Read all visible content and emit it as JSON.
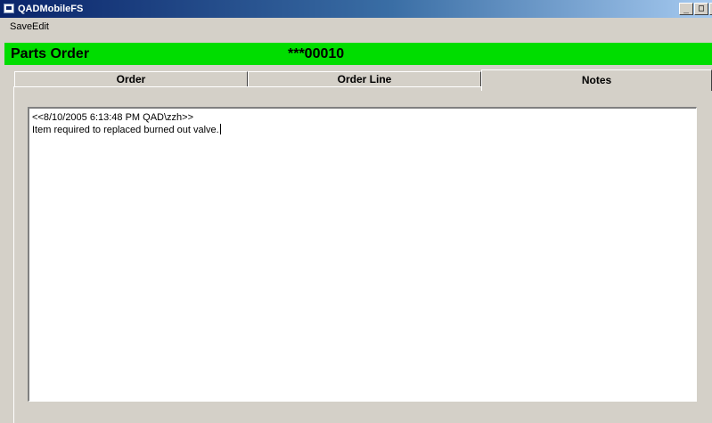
{
  "window": {
    "title": "QADMobileFS",
    "controls": [
      "_",
      "□",
      "×"
    ]
  },
  "menu": {
    "items": [
      "Save",
      "Edit"
    ]
  },
  "header": {
    "title": "Parts Order",
    "order_number": "***00010",
    "accent_color": "#00dd00"
  },
  "tabs": [
    {
      "label": "Order",
      "active": false
    },
    {
      "label": "Order Line",
      "active": false
    },
    {
      "label": "Notes",
      "active": true
    }
  ],
  "notes": {
    "lines": [
      "<<8/10/2005 6:13:48 PM QAD\\zzh>>",
      "Item required to replaced burned out valve."
    ]
  }
}
